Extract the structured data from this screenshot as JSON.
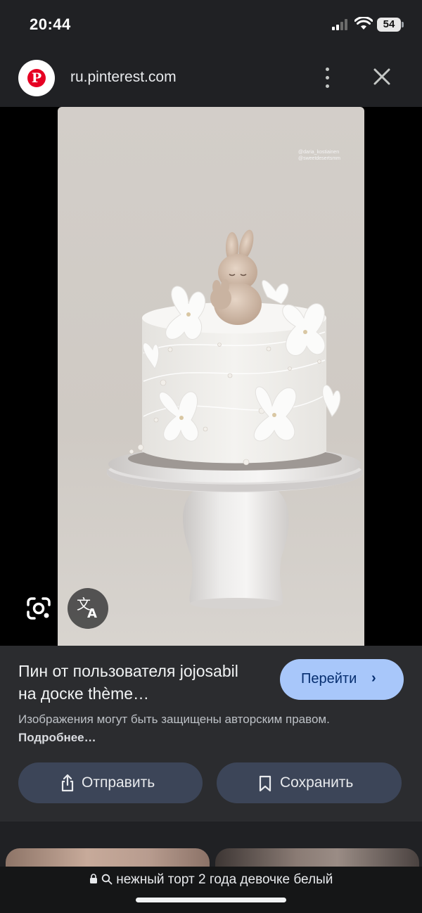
{
  "status_bar": {
    "time": "20:44",
    "battery": "54",
    "icons": [
      "signal-icon",
      "wifi-icon",
      "battery-icon"
    ]
  },
  "url_bar": {
    "site_icon": "pinterest-logo-icon",
    "url": "ru.pinterest.com",
    "icons": [
      "more-vert-icon",
      "close-icon"
    ]
  },
  "photo": {
    "watermark_line1": "@daria_kostiainen",
    "watermark_line2": "@sweetdesertsmm",
    "overlay_buttons": [
      "google-lens-icon",
      "translate-icon"
    ]
  },
  "pin_info": {
    "title": "Пин от пользователя jojosabil на доске thème…",
    "goto_label": "Перейти",
    "copyright_text": "Изображения могут быть защищены авторским правом.",
    "more_link": "Подробнее…",
    "share_label": "Отправить",
    "save_label": "Сохранить"
  },
  "search_bar": {
    "query": "нежный торт 2 года девочке белый"
  },
  "colors": {
    "background": "#202124",
    "panel": "#2b2c2f",
    "primary_button": "#a8c7fa",
    "secondary_button": "#3c4558",
    "pinterest_red": "#e60023"
  }
}
